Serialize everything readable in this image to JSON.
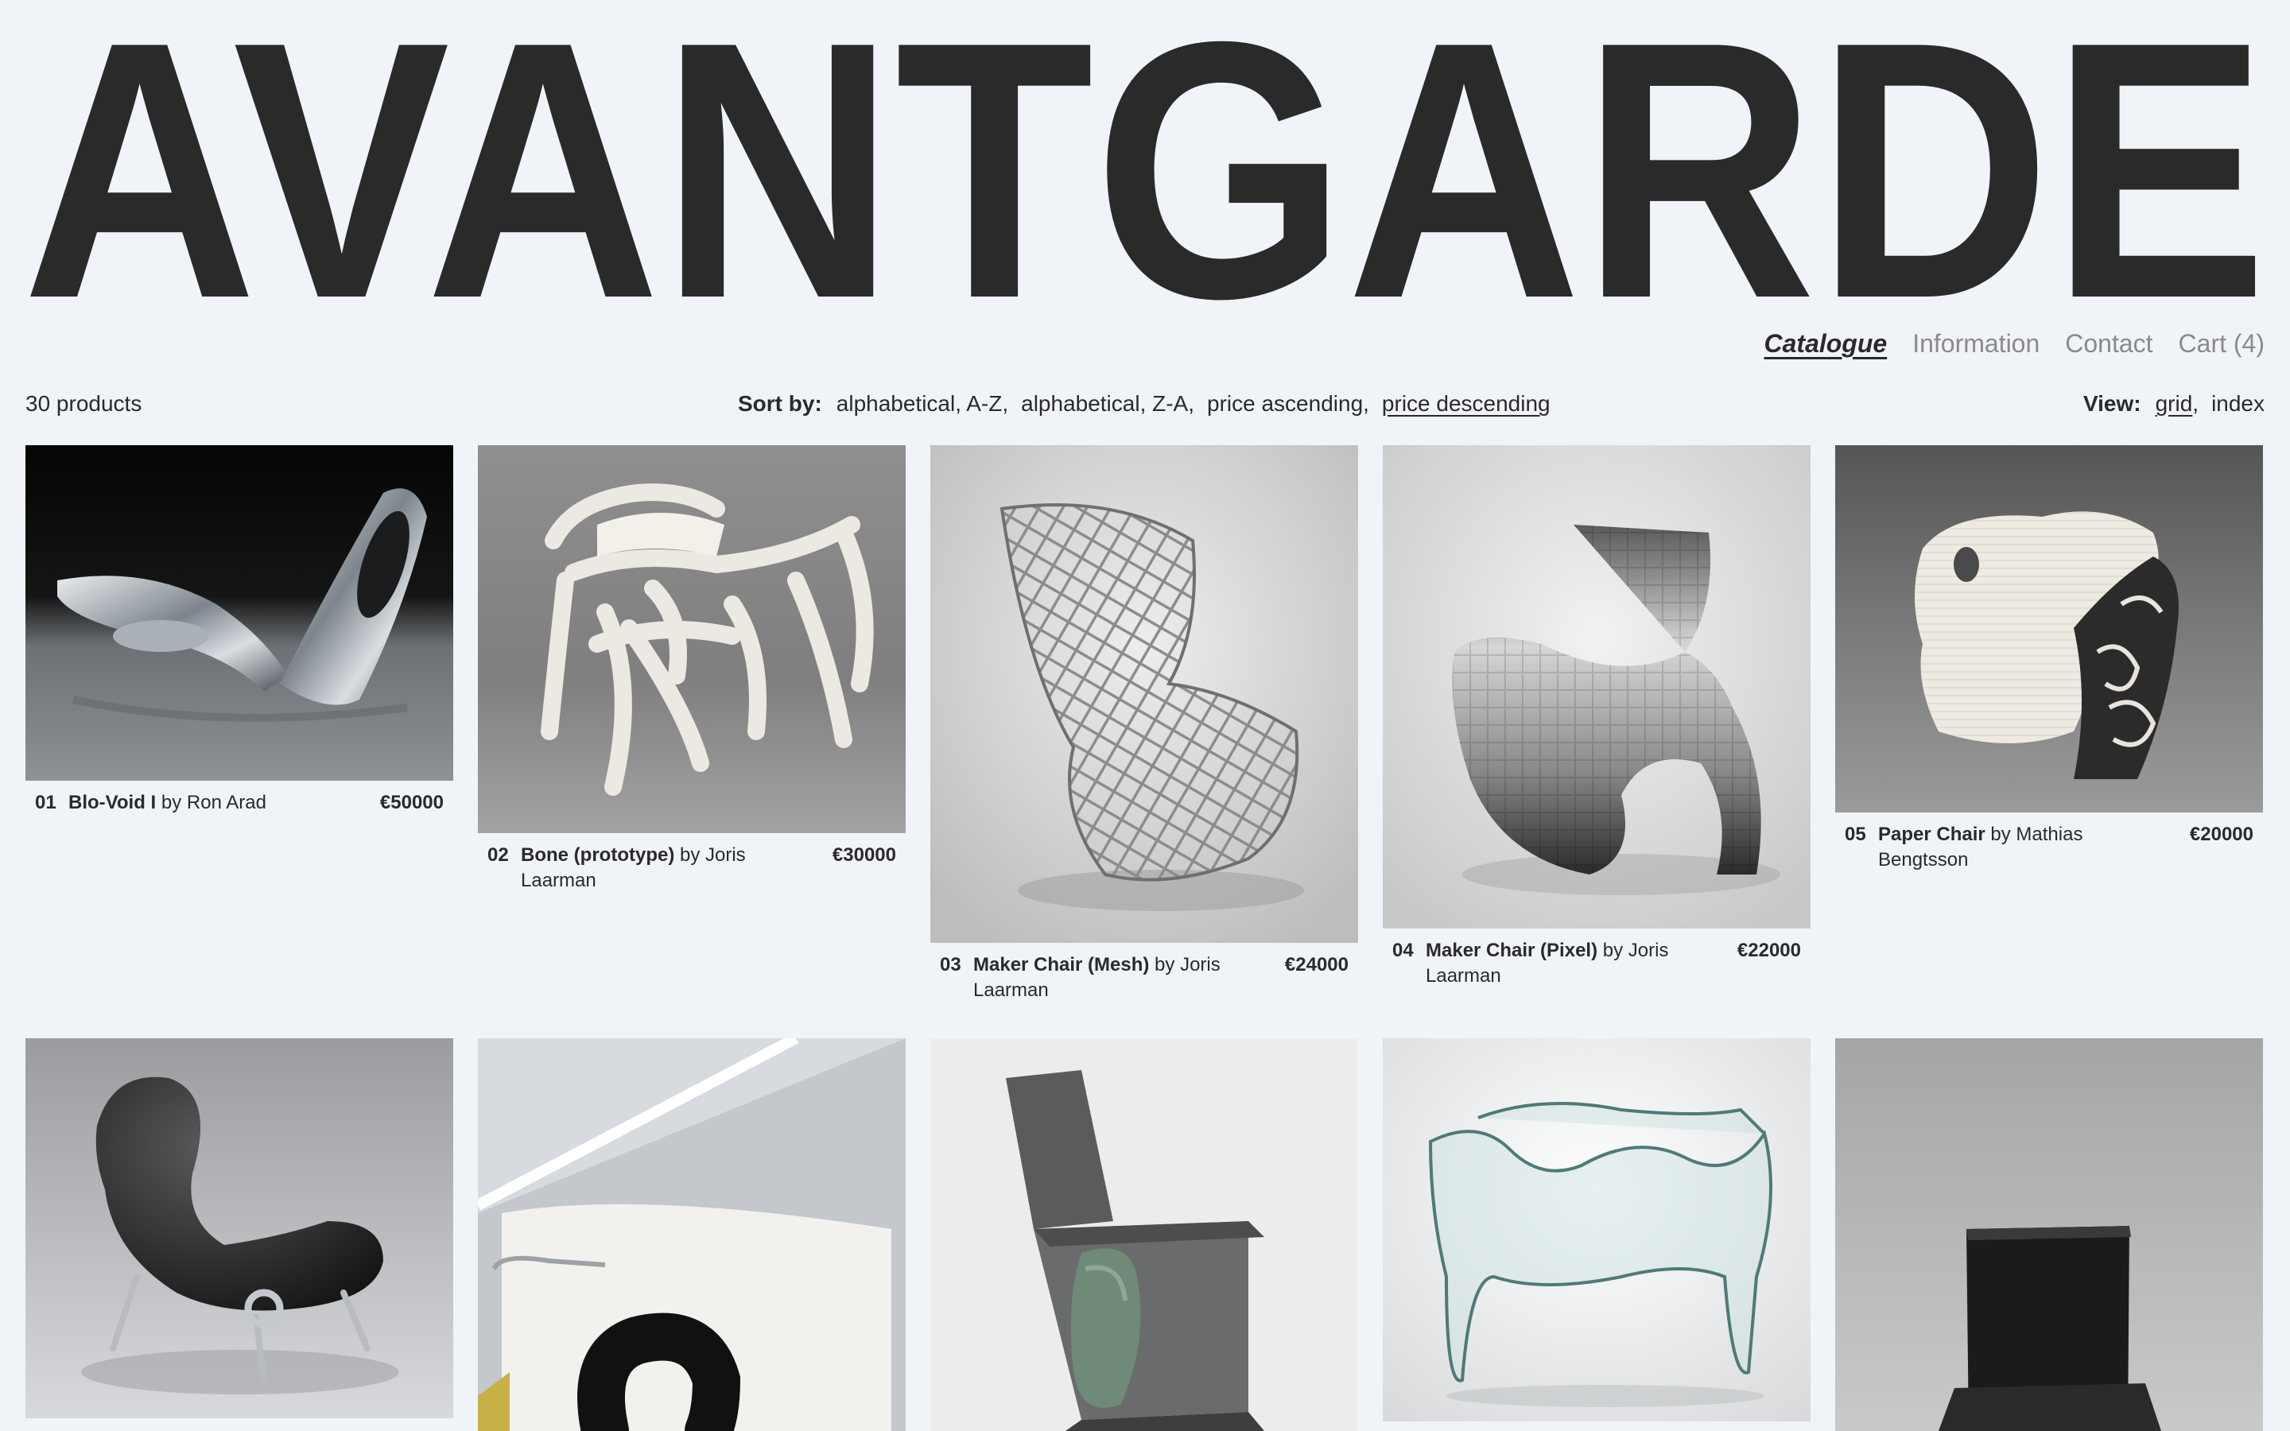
{
  "brand": {
    "title": "AVANTGARDE"
  },
  "nav": {
    "items": [
      {
        "label": "Catalogue",
        "active": true
      },
      {
        "label": "Information",
        "active": false
      },
      {
        "label": "Contact",
        "active": false
      },
      {
        "label": "Cart (4)",
        "active": false
      }
    ]
  },
  "toolbar": {
    "count": "30 products",
    "sort_label": "Sort by:",
    "sort_options": [
      {
        "label": "alphabetical, A-Z,",
        "active": false
      },
      {
        "label": "alphabetical, Z-A,",
        "active": false
      },
      {
        "label": "price ascending,",
        "active": false
      },
      {
        "label": "price descending",
        "active": true
      }
    ],
    "view_label": "View:",
    "view_options": [
      {
        "label": "grid",
        "suffix": ",",
        "active": true
      },
      {
        "label": "index",
        "suffix": "",
        "active": false
      }
    ]
  },
  "products": [
    {
      "num": "01",
      "name": "Blo-Void I",
      "by": " by ",
      "designer": "Ron Arad",
      "price": "€50000"
    },
    {
      "num": "02",
      "name": "Bone (prototype)",
      "by": " by ",
      "designer": "Joris Laarman",
      "price": "€30000"
    },
    {
      "num": "03",
      "name": "Maker Chair (Mesh)",
      "by": " by ",
      "designer": "Joris Laarman",
      "price": "€24000"
    },
    {
      "num": "04",
      "name": "Maker Chair (Pixel)",
      "by": " by ",
      "designer": "Joris Laarman",
      "price": "€22000"
    },
    {
      "num": "05",
      "name": "Paper Chair",
      "by": " by ",
      "designer": "Mathias Bengtsson",
      "price": "€20000"
    }
  ],
  "colors": {
    "background": "#f0f4f9",
    "text": "#2a2a2a",
    "muted": "#8a8a8a"
  }
}
